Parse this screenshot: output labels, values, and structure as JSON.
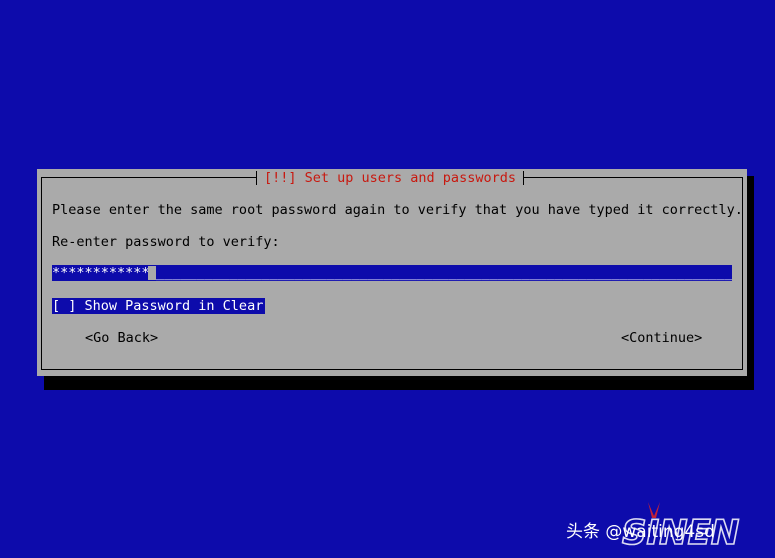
{
  "dialog": {
    "title": "[!!] Set up users and passwords",
    "prompt": "Please enter the same root password again to verify that you have typed it correctly.",
    "field_label": "Re-enter password to verify:",
    "password_value": "************",
    "checkbox_label": "[ ] Show Password in Clear",
    "back_label": "<Go Back>",
    "continue_label": "<Continue>"
  },
  "watermark": {
    "text": "头条 @waiting4sd",
    "logo_text": "SINEN"
  },
  "colors": {
    "background": "#0d0bab",
    "dialog": "#aaaaaa",
    "title": "#c8180f",
    "highlight_text": "#ffffff"
  }
}
